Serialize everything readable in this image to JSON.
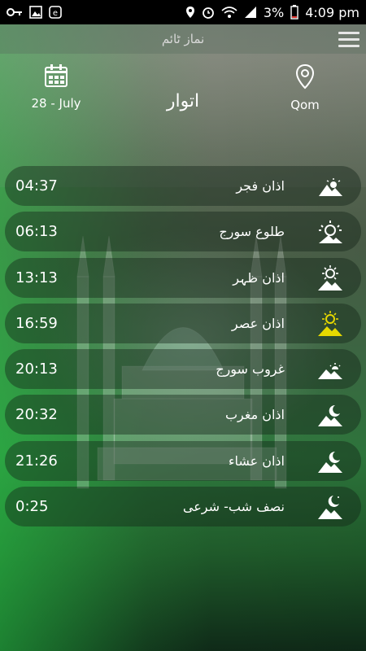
{
  "status_bar": {
    "battery": "3%",
    "time": "4:09 pm"
  },
  "app_bar": {
    "title": "نماز ٹائم",
    "menu_icon": "hamburger-menu-icon"
  },
  "header": {
    "date": "28 - July",
    "day": "اتوار",
    "location": "Qom",
    "date_icon": "calendar-icon",
    "location_icon": "location-pin-icon"
  },
  "prayers": [
    {
      "name": "اذان فجر",
      "time": "04:37",
      "icon": "mountain-dawn-icon"
    },
    {
      "name": "طلوع سورج",
      "time": "06:13",
      "icon": "sunrise-icon"
    },
    {
      "name": "اذان ظہر",
      "time": "13:13",
      "icon": "sun-mountain-icon"
    },
    {
      "name": "اذان عصر",
      "time": "16:59",
      "icon": "sun-mountain-yellow-icon",
      "accent": "#e6d800"
    },
    {
      "name": "غروب سورج",
      "time": "20:13",
      "icon": "sunset-icon"
    },
    {
      "name": "اذان مغرب",
      "time": "20:32",
      "icon": "moon-mountain-icon"
    },
    {
      "name": "اذان عشاء",
      "time": "21:26",
      "icon": "moon-mountain-icon"
    },
    {
      "name": "نصف شب- شرعی",
      "time": "0:25",
      "icon": "crescent-mountain-icon"
    }
  ]
}
